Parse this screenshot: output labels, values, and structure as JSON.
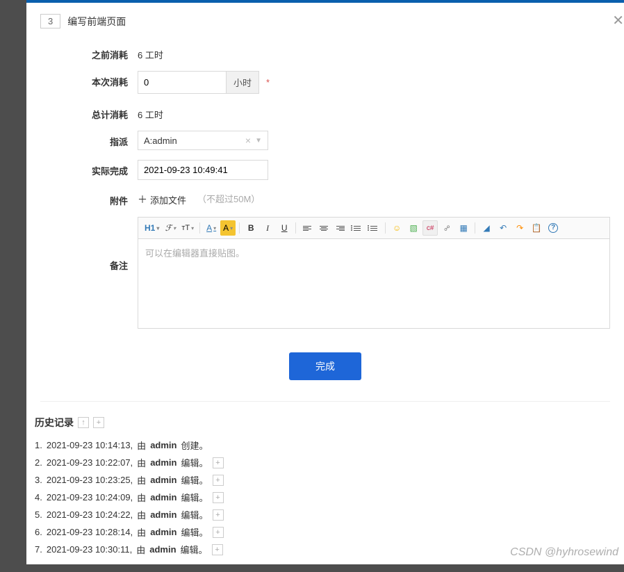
{
  "header": {
    "id": "3",
    "title": "编写前端页面"
  },
  "form": {
    "prev_consumed_label": "之前消耗",
    "prev_consumed_value": "6 工时",
    "this_consumed_label": "本次消耗",
    "this_consumed_value": "0",
    "hour_unit": "小时",
    "total_consumed_label": "总计消耗",
    "total_consumed_value": "6 工时",
    "assign_label": "指派",
    "assign_value": "A:admin",
    "finish_date_label": "实际完成",
    "finish_date_value": "2021-09-23 10:49:41",
    "attachment_label": "附件",
    "add_file_label": "添加文件",
    "file_hint": "（不超过50M）",
    "remark_label": "备注",
    "editor_placeholder": "可以在编辑器直接贴图。",
    "submit_label": "完成"
  },
  "history": {
    "title": "历史记录",
    "items": [
      {
        "idx": "1.",
        "time": "2021-09-23 10:14:13",
        "by": "由",
        "user": "admin",
        "action": "创建。",
        "expand": false
      },
      {
        "idx": "2.",
        "time": "2021-09-23 10:22:07",
        "by": "由",
        "user": "admin",
        "action": "编辑。",
        "expand": true
      },
      {
        "idx": "3.",
        "time": "2021-09-23 10:23:25",
        "by": "由",
        "user": "admin",
        "action": "编辑。",
        "expand": true
      },
      {
        "idx": "4.",
        "time": "2021-09-23 10:24:09",
        "by": "由",
        "user": "admin",
        "action": "编辑。",
        "expand": true
      },
      {
        "idx": "5.",
        "time": "2021-09-23 10:24:22",
        "by": "由",
        "user": "admin",
        "action": "编辑。",
        "expand": true
      },
      {
        "idx": "6.",
        "time": "2021-09-23 10:28:14",
        "by": "由",
        "user": "admin",
        "action": "编辑。",
        "expand": true
      },
      {
        "idx": "7.",
        "time": "2021-09-23 10:30:11",
        "by": "由",
        "user": "admin",
        "action": "编辑。",
        "expand": true
      }
    ]
  },
  "watermark": "CSDN @hyhrosewind"
}
